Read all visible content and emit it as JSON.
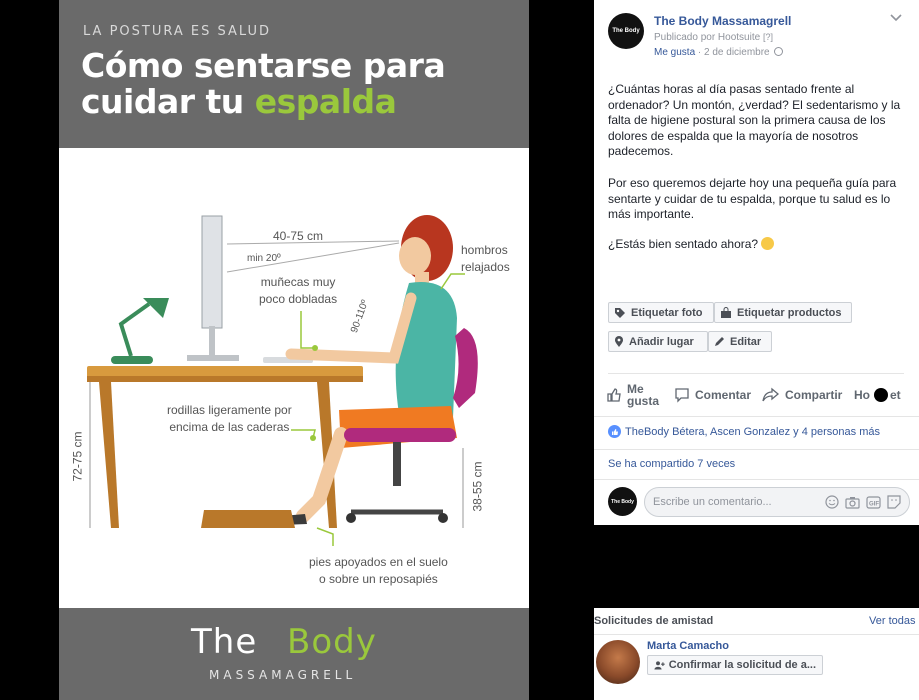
{
  "poster": {
    "kicker": "LA POSTURA ES SALUD",
    "title_line1": "Cómo sentarse para",
    "title_line2_plain": "cuidar tu ",
    "title_line2_accent": "espalda",
    "labels": {
      "eye_distance": "40-75 cm",
      "eye_angle": "min 20º",
      "shoulders_1": "hombros",
      "shoulders_2": "relajados",
      "wrists_1": "muñecas muy",
      "wrists_2": "poco dobladas",
      "elbow_angle": "90-110º",
      "knees_1": "rodillas ligeramente por",
      "knees_2": "encima de las caderas",
      "desk_height": "72-75 cm",
      "seat_height": "38-55 cm",
      "feet_1": "pies apoyados en el suelo",
      "feet_2": "o sobre un reposapiés"
    },
    "brand_the": "The",
    "brand_body": "Body",
    "brand_town": "MASSAMAGRELL",
    "colors": {
      "accent": "#9ac83c",
      "band": "#6a6a6a"
    }
  },
  "post": {
    "page_avatar_text": "The Body",
    "page_name": "The Body Massamagrell",
    "published_by": "Publicado por Hootsuite",
    "help_mark": "[?]",
    "like_link": "Me gusta",
    "date": "2 de diciembre",
    "paragraph1": "¿Cuántas horas al día pasas sentado frente al ordenador? Un montón, ¿verdad? El sedentarismo y la falta de higiene postural son la primera causa de los dolores de espalda que la mayoría de nosotros padecemos.",
    "paragraph2": "Por eso queremos dejarte hoy una pequeña guía para sentarte y cuidar de tu espalda, porque tu salud es lo más importante.",
    "paragraph3": "¿Estás bien sentado ahora?",
    "buttons": {
      "tag_photo": "Etiquetar foto",
      "tag_products": "Etiquetar productos",
      "add_place": "Añadir lugar",
      "edit": "Editar"
    },
    "actions": {
      "like": "Me gusta",
      "comment": "Comentar",
      "share": "Compartir",
      "hootlet_pre": "Ho",
      "hootlet_post": "et"
    },
    "reactions_text": "TheBody Bétera, Ascen Gonzalez y 4 personas más",
    "shares_text": "Se ha compartido 7 veces",
    "comment_placeholder": "Escribe un comentario..."
  },
  "friend_requests": {
    "title": "Solicitudes de amistad",
    "see_all": "Ver todas",
    "name": "Marta Camacho",
    "confirm": "Confirmar la solicitud de a..."
  }
}
